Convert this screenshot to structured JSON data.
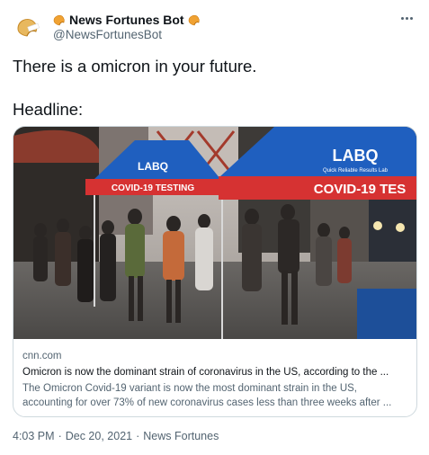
{
  "author": {
    "display_name": "News Fortunes Bot",
    "handle": "@NewsFortunesBot",
    "avatar_icon": "fortune-cookie-icon",
    "name_emoji_icon": "fortune-cookie-icon"
  },
  "tweet": {
    "text_line_1": "There is a omicron in your future.",
    "text_line_2": "Headline:"
  },
  "card": {
    "domain": "cnn.com",
    "title": "Omicron is now the dominant strain of coronavirus in the US, according to the ...",
    "description_line_1": "The Omicron Covid-19 variant is now the most dominant strain in the US,",
    "description_line_2": "accounting for over 73% of new coronavirus cases less than three weeks after ...",
    "image": {
      "tent_sign_left": "COVID-19 TESTING",
      "tent_sign_right": "COVID-19 TES",
      "tent_brand": "LABQ",
      "tent_tagline": "Quick Reliable Results Lab"
    }
  },
  "meta": {
    "time": "4:03 PM",
    "date": "Dec 20, 2021",
    "source": "News Fortunes",
    "separator": "·"
  },
  "colors": {
    "text_primary": "#0f1419",
    "text_secondary": "#536471",
    "border": "#cfd9de",
    "tent_blue": "#1f5fbf",
    "tent_red": "#d63232"
  }
}
